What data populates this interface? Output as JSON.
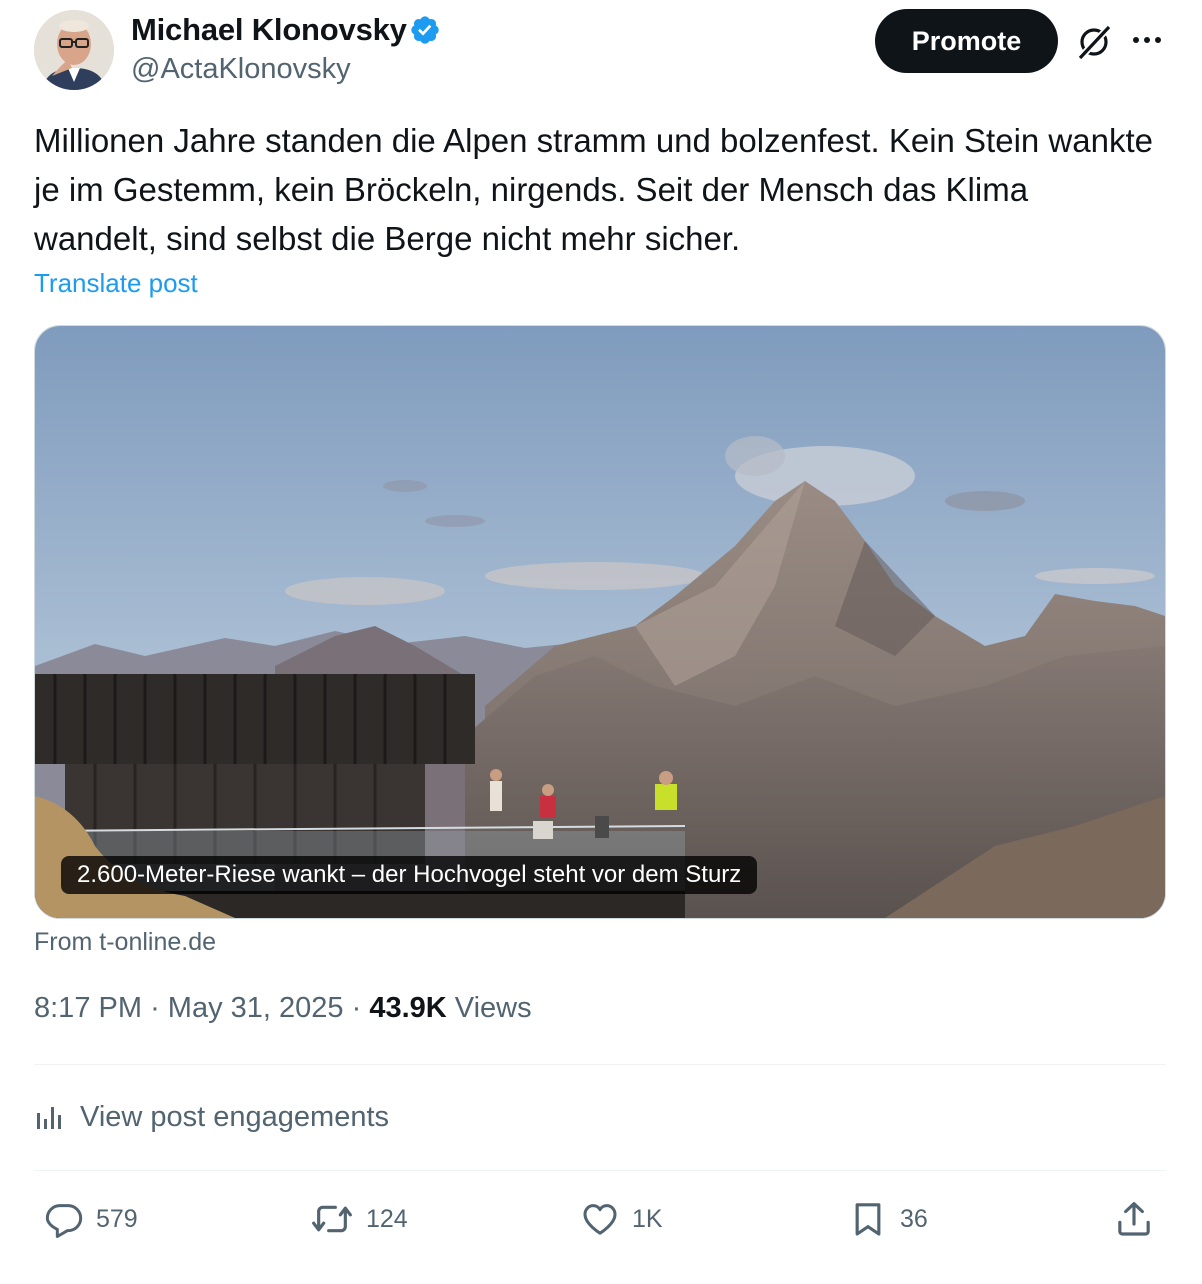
{
  "author": {
    "name": "Michael Klonovsky",
    "handle": "@ActaKlonovsky",
    "verified": true
  },
  "header_actions": {
    "promote_label": "Promote",
    "grok_icon": "grok-icon",
    "more_icon": "more-icon"
  },
  "post": {
    "text": "Millionen Jahre standen die Alpen stramm und bolzenfest. Kein Stein wankte je im Gestemm, kein Bröckeln, nirgends. Seit der Mensch das Klima wandelt, sind selbst die Berge nicht mehr sicher.",
    "translate_label": "Translate post"
  },
  "link_card": {
    "headline": "2.600-Meter-Riese wankt – der Hochvogel steht vor dem Sturz",
    "source": "From t-online.de"
  },
  "meta": {
    "time": "8:17 PM",
    "date": "May 31, 2025",
    "separator": "·",
    "views_count": "43.9K",
    "views_label": "Views"
  },
  "engagements_label": "View post engagements",
  "actions": {
    "replies": "579",
    "reposts": "124",
    "likes": "1K",
    "bookmarks": "36"
  },
  "colors": {
    "text_primary": "#0f1419",
    "text_secondary": "#536471",
    "accent": "#1d9bf0",
    "button_dark": "#0f1419"
  }
}
